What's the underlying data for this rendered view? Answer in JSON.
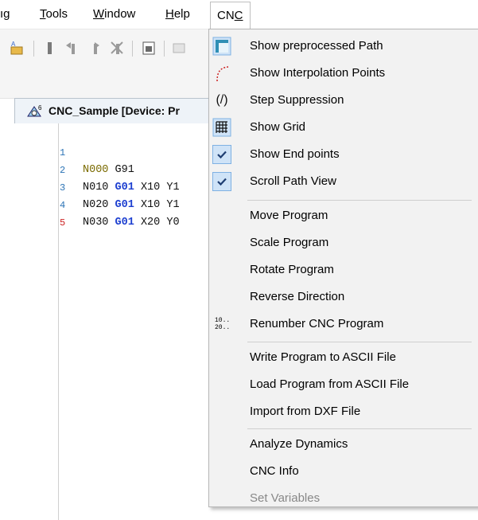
{
  "menubar": {
    "items": [
      {
        "label": "ıg",
        "mnemonic": ""
      },
      {
        "label": "Tools",
        "mnemonic": "T"
      },
      {
        "label": "Window",
        "mnemonic": "W"
      },
      {
        "label": "Help",
        "mnemonic": "H"
      },
      {
        "label": "CNC",
        "mnemonic": "C"
      }
    ]
  },
  "editor": {
    "tab_title": "CNC_Sample [Device: Pr",
    "lines": [
      {
        "num": "1",
        "n": "N000",
        "rest": "G91",
        "g": ""
      },
      {
        "num": "2",
        "n": "N010",
        "g": "G01",
        "rest": "X10 Y1"
      },
      {
        "num": "3",
        "n": "N020",
        "g": "G01",
        "rest": "X10 Y1"
      },
      {
        "num": "4",
        "n": "N030",
        "g": "G01",
        "rest": "X20 Y0"
      },
      {
        "num": "5",
        "n": "",
        "g": "",
        "rest": ""
      }
    ]
  },
  "menu": {
    "items": [
      {
        "label": "Show preprocessed Path",
        "icon": "preprocessed-path-icon"
      },
      {
        "label": "Show Interpolation Points",
        "icon": "interpolation-points-icon"
      },
      {
        "label": "Step Suppression",
        "icon": "step-suppression-icon"
      },
      {
        "label": "Show Grid",
        "icon": "grid-icon"
      },
      {
        "label": "Show End points",
        "icon": "checkmark-icon",
        "checked": true
      },
      {
        "label": "Scroll Path View",
        "icon": "checkmark-icon",
        "checked": true
      },
      {
        "label": "Move Program"
      },
      {
        "label": "Scale Program"
      },
      {
        "label": "Rotate Program"
      },
      {
        "label": "Reverse Direction"
      },
      {
        "label": "Renumber CNC Program",
        "icon": "renumber-icon"
      },
      {
        "label": "Write Program to ASCII File"
      },
      {
        "label": "Load Program from ASCII File"
      },
      {
        "label": "Import from DXF File"
      },
      {
        "label": "Analyze Dynamics"
      },
      {
        "label": "CNC Info"
      },
      {
        "label": "Set Variables",
        "disabled": true
      }
    ],
    "renumber_icon_text": "10..\n20..",
    "step_suppression_icon_text": "(/)"
  }
}
